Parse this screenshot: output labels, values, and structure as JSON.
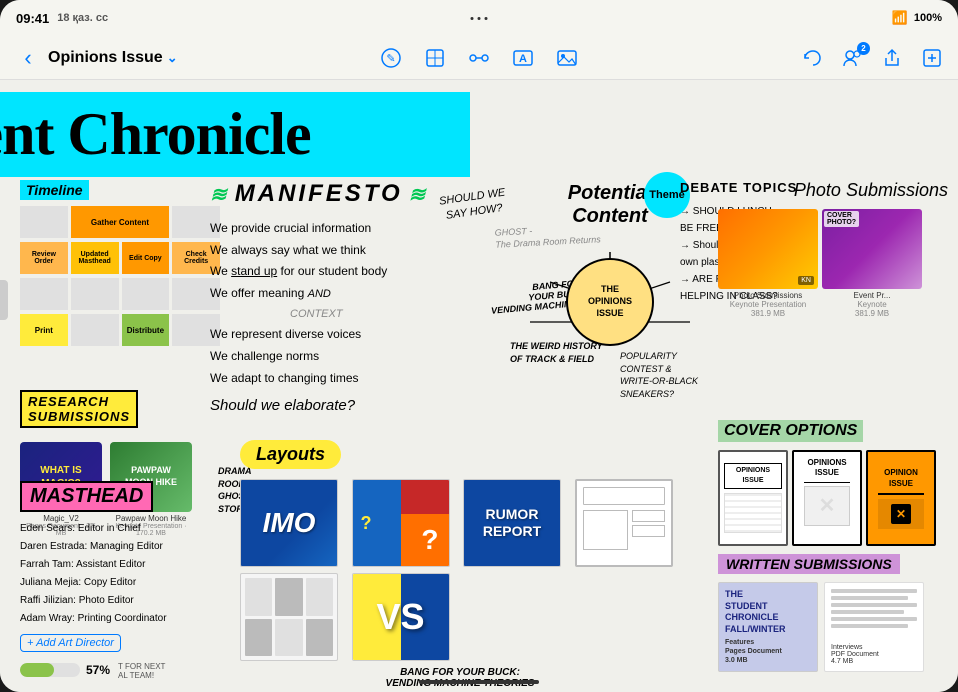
{
  "status_bar": {
    "time": "09:41",
    "date": "18 қаз. сс",
    "wifi": "WiFi",
    "battery": "100%",
    "dots": [
      "•",
      "•",
      "•"
    ]
  },
  "toolbar": {
    "back_label": "‹",
    "title": "Opinions Issue",
    "title_chevron": "⌄",
    "tools": [
      "✎",
      "⊞",
      "⊙",
      "T",
      "⊡"
    ],
    "right_tools": [
      "↺",
      "👥 2",
      "↑",
      "✏"
    ]
  },
  "canvas": {
    "big_title": "The Student Chronicle",
    "timeline": {
      "label": "Timeline",
      "rows": [
        [
          "Gather Content",
          "",
          "",
          ""
        ],
        [
          "Review Order",
          "Updated Masthead",
          "Edit Copy",
          "Check Credits"
        ],
        [
          "",
          "",
          "",
          ""
        ],
        [
          "Print",
          "",
          "Distribute",
          ""
        ]
      ]
    },
    "manifesto": {
      "label": "MANIFESTO",
      "items": [
        "We provide crucial information",
        "We always say what we think",
        "We stand up for our student body",
        "We offer meaning",
        "We represent diverse voices",
        "We challenge norms",
        "We adapt to changing times"
      ],
      "question": "Should we elaborate?",
      "and_context": "AND CONTEXT",
      "should_we_say": "SHOULD WE\nSAY HOW?"
    },
    "potential_content": {
      "title": "Potential\nContent",
      "theme": "Theme",
      "center_label": "THE OPINIONS ISSUE",
      "ghost_items": [
        "Ghost",
        "The Drama Room Returns"
      ],
      "bang_text": "BANG FOR\nYOUR BUCK:\nVENDING MACHINE THEORIES",
      "weird_history": "THE WEIRD HISTORY\nOF TRACK & FIELD",
      "popularity": "POPULARITY\nCONTEST &\nWRITE-OR-BLACK\nSNEAKERS?"
    },
    "debate_topics": {
      "title": "DEBATE TOPICS",
      "items": [
        "SHOULD LUNCH BE FREE?",
        "Should we own plastics?",
        "ARE PHONES HELPING IN CLASS?"
      ]
    },
    "photo_submissions": {
      "title": "Photo Submissions",
      "photos": [
        {
          "label": "Photo Submissions",
          "type": "keynote",
          "size": "381.9 MB"
        },
        {
          "label": "Event Pr...",
          "type": "keynote",
          "size": "381.9 MB"
        }
      ]
    },
    "research_submissions": {
      "label": "RESEARCH SUBMISSIONS",
      "docs": [
        {
          "title": "WHAT IS MAGIC?",
          "name": "Magic_V2",
          "type": "Pages Document",
          "size": "2.5 MB"
        },
        {
          "title": "PAWPAW MOON HIKE",
          "name": "Pawpaw Moon Hike",
          "type": "Keynote Presentation",
          "size": "170.2 MB"
        }
      ]
    },
    "masthead": {
      "label": "MASTHEAD",
      "members": [
        "Eden Sears: Editor in Chief",
        "Daren Estrada: Managing Editor",
        "Farrah Tam: Assistant Editor",
        "Juliana Mejia: Copy Editor",
        "Raffi Jilizian: Photo Editor",
        "Adam Wray: Printing Coordinator"
      ],
      "add_label": "+ Add Art Director"
    },
    "layouts": {
      "label": "Layouts",
      "items": [
        {
          "label": "IMO",
          "color": "blue"
        },
        {
          "label": "?",
          "color": "mixed"
        },
        {
          "label": "RUMOR REPORT",
          "color": "blue"
        },
        {
          "label": "?",
          "color": "white"
        },
        {
          "label": "⊞",
          "color": "gray"
        },
        {
          "label": "VS",
          "color": "yellow-blue"
        }
      ],
      "drama_note": "DRAMA ROOM GHOST STORY"
    },
    "bang_bottom": "BANG FOR YOUR BUCK:\nVENDING MACHINE THEORIES",
    "cover_options": {
      "label": "COVER OPTIONS",
      "covers": [
        {
          "label": "OPINIONS ISSUE",
          "type": "outline"
        },
        {
          "label": "OPINIONS ISSUE",
          "type": "bold"
        },
        {
          "label": "OPINION ISSUE",
          "type": "colored"
        }
      ]
    },
    "written_submissions": {
      "label": "WRITTEN SUBMISSIONS",
      "docs": [
        {
          "title": "THE STUDENT CHRONICLE FALL/WINTER",
          "sub": "Features",
          "type": "Pages Document",
          "size": "3.0 MB"
        },
        {
          "title": "Interviews",
          "type": "PDF Document",
          "size": "4.7 MB"
        }
      ]
    },
    "progress": {
      "percent": "57%",
      "note": "T FOR NEXT AL TEAM!"
    }
  }
}
